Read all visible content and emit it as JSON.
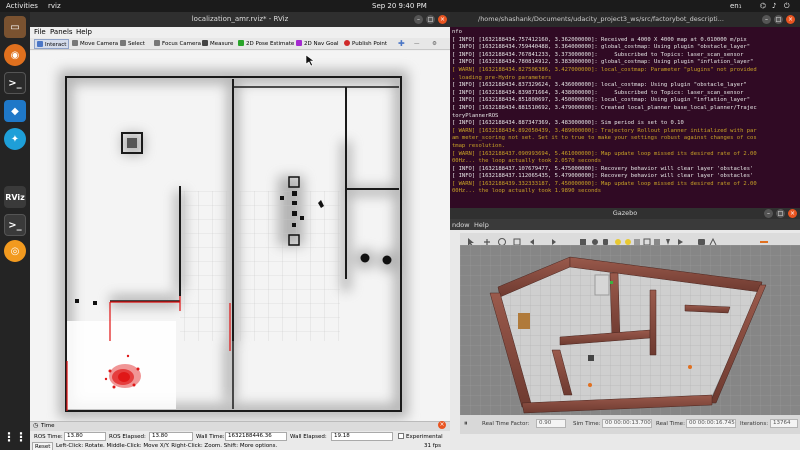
{
  "topbar": {
    "activities": "Activities",
    "app_name": "rviz",
    "clock": "Sep 20  9:40 PM",
    "tray": "en₁"
  },
  "dock": {
    "items": [
      {
        "name": "files",
        "color": "#6b4a35"
      },
      {
        "name": "firefox",
        "color": "#e0701e"
      },
      {
        "name": "terminal",
        "color": "#2b2b2b"
      },
      {
        "name": "vscode",
        "color": "#1f78c8"
      },
      {
        "name": "settings",
        "color": "#1e9fd8"
      },
      {
        "name": "rviz",
        "color": "#3a3a3a",
        "label": "RViz"
      },
      {
        "name": "terminal2",
        "color": "#3a3a3a"
      },
      {
        "name": "gazebo",
        "color": "#f29a1f"
      }
    ]
  },
  "rviz": {
    "title": "localization_amr.rviz* - RViz",
    "menu": [
      "File",
      "Panels",
      "Help"
    ],
    "toolbar": [
      {
        "label": "Interact",
        "color": "#4a76c6"
      },
      {
        "label": "Move Camera",
        "color": "#777777"
      },
      {
        "label": "Select",
        "color": "#777777"
      },
      {
        "label": "Focus Camera",
        "color": "#777777"
      },
      {
        "label": "Measure",
        "color": "#444444"
      },
      {
        "label": "2D Pose Estimate",
        "color": "#2aa42a"
      },
      {
        "label": "2D Nav Goal",
        "color": "#a42ad0"
      },
      {
        "label": "Publish Point",
        "color": "#d02a2a"
      }
    ],
    "time_panel": {
      "header": "Time",
      "ros_time_label": "ROS Time:",
      "ros_time": "13.80",
      "ros_elapsed_label": "ROS Elapsed:",
      "ros_elapsed": "13.80",
      "wall_time_label": "Wall Time:",
      "wall_time": "1632188446.36",
      "wall_elapsed_label": "Wall Elapsed:",
      "wall_elapsed": "19.18",
      "experimental": "Experimental",
      "reset": "Reset",
      "hint": "Left-Click: Rotate. Middle-Click: Move X/Y. Right-Click: Zoom. Shift: More options.",
      "fps": "31 fps"
    }
  },
  "terminal": {
    "title": "/home/shashank/Documents/udacity_project3_ws/src/factorybot_descripti...",
    "lines": [
      {
        "t": "nfo",
        "c": "info"
      },
      {
        "t": "[ INFO] [1632188434.757412160, 3.362000000]: Received a 4000 X 4000 map at 0.010000 m/pix",
        "c": "info"
      },
      {
        "t": "[ INFO] [1632188434.759440488, 3.364000000]: global_costmap: Using plugin \"obstacle_layer\"",
        "c": "info"
      },
      {
        "t": "[ INFO] [1632188434.767841233, 3.373000000]:     Subscribed to Topics: laser_scan_sensor",
        "c": "info"
      },
      {
        "t": "[ INFO] [1632188434.780814912, 3.383000000]: global_costmap: Using plugin \"inflation_layer\"",
        "c": "info"
      },
      {
        "t": "[ WARN] [1632188434.827506386, 3.427000000]: local_costmap: Parameter \"plugins\" not provided",
        "c": "warn"
      },
      {
        "t": ", loading pre-Hydro parameters",
        "c": "warn"
      },
      {
        "t": "[ INFO] [1632188434.837329624, 3.436000000]: local_costmap: Using plugin \"obstacle_layer\"",
        "c": "info"
      },
      {
        "t": "[ INFO] [1632188434.839871664, 3.438000000]:     Subscribed to Topics: laser_scan_sensor",
        "c": "info"
      },
      {
        "t": "[ INFO] [1632188434.851800697, 3.450000000]: local_costmap: Using plugin \"inflation_layer\"",
        "c": "info"
      },
      {
        "t": "[ INFO] [1632188434.881510692, 3.479000000]: Created local_planner base_local_planner/Trajec",
        "c": "info"
      },
      {
        "t": "toryPlannerROS",
        "c": "info"
      },
      {
        "t": "[ INFO] [1632188434.887347369, 3.483000000]: Sim period is set to 0.10",
        "c": "info"
      },
      {
        "t": "[ WARN] [1632188434.892050439, 3.489000000]: Trajectory Rollout planner initialized with par",
        "c": "warn"
      },
      {
        "t": "am meter_scoring not set. Set it to true to make your settings robust against changes of cos",
        "c": "warn"
      },
      {
        "t": "tmap resolution.",
        "c": "warn"
      },
      {
        "t": "[ WARN] [1632188437.090993694, 5.461000000]: Map update loop missed its desired rate of 2.00",
        "c": "warn"
      },
      {
        "t": "00Hz... the loop actually took 2.0570 seconds",
        "c": "warn"
      },
      {
        "t": "[ INFO] [1632188437.107679477, 5.475000000]: Recovery behavior will clear layer 'obstacles'",
        "c": "info"
      },
      {
        "t": "[ INFO] [1632188437.112065435, 5.479000000]: Recovery behavior will clear layer 'obstacles'",
        "c": "info"
      },
      {
        "t": "[ WARN] [1632188439.332333187, 7.450000000]: Map update loop missed its desired rate of 2.00",
        "c": "warn"
      },
      {
        "t": "00Hz... the loop actually took 1.9890 seconds",
        "c": "warn"
      }
    ]
  },
  "gazebo": {
    "title": "Gazebo",
    "menu": [
      "ndow",
      "Help"
    ],
    "status": {
      "rtf_label": "Real Time Factor:",
      "rtf": "0.90",
      "sim_label": "Sim Time:",
      "sim": "00 00:00:13.700",
      "real_label": "Real Time:",
      "real": "00 00:00:16.745",
      "iter_label": "Iterations:",
      "iter": "13764"
    }
  }
}
